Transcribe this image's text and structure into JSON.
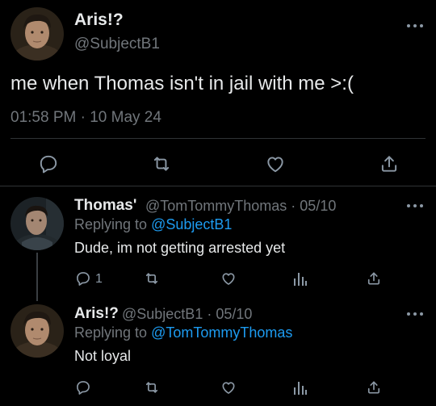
{
  "main_tweet": {
    "display_name": "Aris!?",
    "handle": "@SubjectB1",
    "text": "me when Thomas isn't in jail with me >:(",
    "timestamp": "01:58 PM · 10 May 24"
  },
  "main_actions": {
    "reply_icon": "reply-icon",
    "retweet_icon": "retweet-icon",
    "like_icon": "like-icon",
    "share_icon": "share-icon"
  },
  "replies": [
    {
      "display_name": "Thomas'",
      "handle_date": "@TomTommyThomas · 05/10",
      "replying_prefix": "Replying to ",
      "replying_to": "@SubjectB1",
      "text": "Dude, im not getting arrested yet",
      "reply_count": "1"
    },
    {
      "display_name": "Aris!?",
      "handle_date": "@SubjectB1 · 05/10",
      "replying_prefix": "Replying to ",
      "replying_to": "@TomTommyThomas",
      "text": "Not loyal",
      "reply_count": ""
    }
  ],
  "colors": {
    "background": "#000000",
    "text": "#e7e9ea",
    "secondary": "#71767b",
    "link": "#1d9bf0"
  }
}
